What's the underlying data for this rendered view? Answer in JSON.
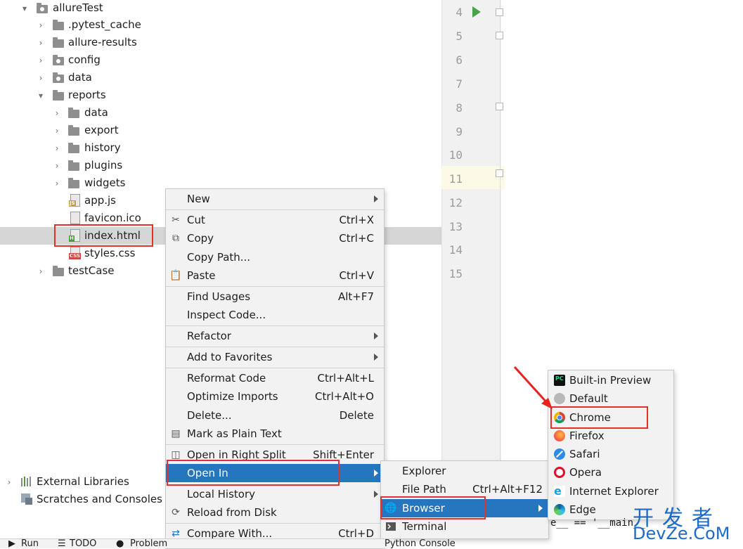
{
  "project_tree": {
    "items": [
      {
        "label": "allureTest",
        "type": "folder",
        "expanded": true
      },
      {
        "label": ".pytest_cache",
        "type": "folder"
      },
      {
        "label": "allure-results",
        "type": "folder"
      },
      {
        "label": "config",
        "type": "folder"
      },
      {
        "label": "data",
        "type": "folder"
      },
      {
        "label": "reports",
        "type": "folder",
        "expanded": true
      },
      {
        "label": "data",
        "type": "folder"
      },
      {
        "label": "export",
        "type": "folder"
      },
      {
        "label": "history",
        "type": "folder"
      },
      {
        "label": "plugins",
        "type": "folder"
      },
      {
        "label": "widgets",
        "type": "folder"
      },
      {
        "label": "app.js",
        "type": "file",
        "tag": "JS"
      },
      {
        "label": "favicon.ico",
        "type": "file"
      },
      {
        "label": "index.html",
        "type": "file",
        "tag": "H",
        "selected": true
      },
      {
        "label": "styles.css",
        "type": "file",
        "tag": "CSS"
      },
      {
        "label": "testCase",
        "type": "folder"
      }
    ],
    "external_libraries": "External Libraries",
    "scratches": "Scratches and Consoles"
  },
  "editor": {
    "line_numbers": [
      "4",
      "5",
      "6",
      "7",
      "8",
      "9",
      "10",
      "11",
      "12",
      "13",
      "14",
      "15"
    ],
    "current_line": "11",
    "code_fragment": "e__ == '__main__"
  },
  "context_menu": {
    "items": [
      {
        "label": "New",
        "shortcut": "",
        "submenu": true
      },
      {
        "label": "Cut",
        "shortcut": "Ctrl+X",
        "icon": "scissors-icon"
      },
      {
        "label": "Copy",
        "shortcut": "Ctrl+C",
        "icon": "copy-icon"
      },
      {
        "label": "Copy Path...",
        "shortcut": ""
      },
      {
        "label": "Paste",
        "shortcut": "Ctrl+V",
        "icon": "paste-icon"
      },
      {
        "label": "Find Usages",
        "shortcut": "Alt+F7"
      },
      {
        "label": "Inspect Code...",
        "shortcut": ""
      },
      {
        "label": "Refactor",
        "shortcut": "",
        "submenu": true
      },
      {
        "label": "Add to Favorites",
        "shortcut": "",
        "submenu": true
      },
      {
        "label": "Reformat Code",
        "shortcut": "Ctrl+Alt+L"
      },
      {
        "label": "Optimize Imports",
        "shortcut": "Ctrl+Alt+O"
      },
      {
        "label": "Delete...",
        "shortcut": "Delete"
      },
      {
        "label": "Mark as Plain Text",
        "shortcut": "",
        "icon": "plain-text-icon"
      },
      {
        "label": "Open in Right Split",
        "shortcut": "Shift+Enter",
        "icon": "split-icon"
      },
      {
        "label": "Open In",
        "shortcut": "",
        "submenu": true,
        "active": true
      },
      {
        "label": "Local History",
        "shortcut": "",
        "submenu": true
      },
      {
        "label": "Reload from Disk",
        "shortcut": "",
        "icon": "reload-icon"
      },
      {
        "label": "Compare With...",
        "shortcut": "Ctrl+D",
        "icon": "compare-icon"
      }
    ]
  },
  "open_in_menu": {
    "items": [
      {
        "label": "Explorer",
        "shortcut": ""
      },
      {
        "label": "File Path",
        "shortcut": "Ctrl+Alt+F12"
      },
      {
        "label": "Browser",
        "shortcut": "",
        "submenu": true,
        "active": true
      },
      {
        "label": "Terminal",
        "shortcut": "",
        "icon": "terminal-icon"
      }
    ]
  },
  "browser_menu": {
    "items": [
      {
        "label": "Built-in Preview",
        "icon": "pycharm-icon"
      },
      {
        "label": "Default",
        "icon": "globe-icon"
      },
      {
        "label": "Chrome",
        "icon": "chrome-icon"
      },
      {
        "label": "Firefox",
        "icon": "firefox-icon"
      },
      {
        "label": "Safari",
        "icon": "safari-icon"
      },
      {
        "label": "Opera",
        "icon": "opera-icon"
      },
      {
        "label": "Internet Explorer",
        "icon": "ie-icon"
      },
      {
        "label": "Edge",
        "icon": "edge-icon"
      }
    ]
  },
  "bottom_bar": {
    "run": "Run",
    "todo": "TODO",
    "problems": "Problem",
    "python_console": "Python Console"
  },
  "watermark": {
    "chinese": "开发者",
    "latin": "DevZe.CoM"
  },
  "colors": {
    "selection": "#2675bf",
    "highlight_box": "#e03030",
    "tree_selected": "#d5d5d5",
    "run_arrow": "#49a34b"
  }
}
